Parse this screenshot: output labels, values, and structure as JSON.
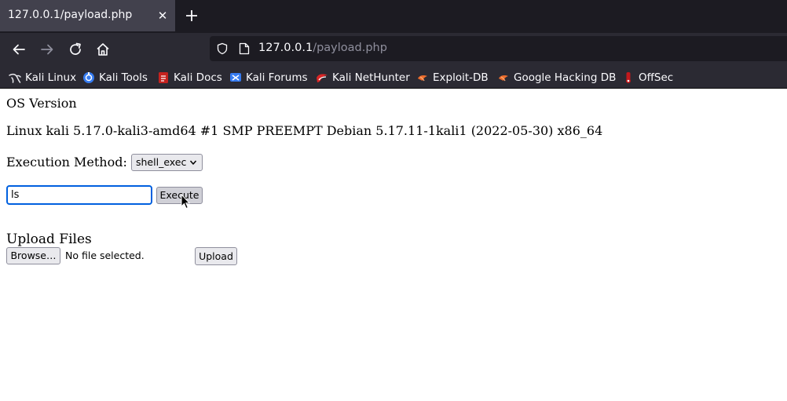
{
  "tab": {
    "title": "127.0.0.1/payload.php",
    "close_glyph": "✕"
  },
  "address_bar": {
    "host": "127.0.0.1",
    "path": "/payload.php"
  },
  "bookmarks": [
    {
      "label": "Kali Linux",
      "icon": "kali-dragon-icon"
    },
    {
      "label": "Kali Tools",
      "icon": "kali-tools-icon"
    },
    {
      "label": "Kali Docs",
      "icon": "kali-docs-icon"
    },
    {
      "label": "Kali Forums",
      "icon": "kali-forums-icon"
    },
    {
      "label": "Kali NetHunter",
      "icon": "kali-nethunter-icon"
    },
    {
      "label": "Exploit-DB",
      "icon": "exploit-db-icon"
    },
    {
      "label": "Google Hacking DB",
      "icon": "ghdb-icon"
    },
    {
      "label": "OffSec",
      "icon": "offsec-icon"
    }
  ],
  "page": {
    "os_heading": "OS Version",
    "os_string": "Linux kali 5.17.0-kali3-amd64 #1 SMP PREEMPT Debian 5.17.11-1kali1 (2022-05-30) x86_64",
    "exec_label": "Execution Method:",
    "exec_method_selected": "shell_exec",
    "command_value": "ls",
    "execute_label": "Execute",
    "upload_heading": "Upload Files",
    "browse_label": "Browse…",
    "file_status": "No file selected.",
    "upload_label": "Upload"
  },
  "colors": {
    "tabbar_bg": "#1c1b22",
    "toolbar_bg": "#2b2a33",
    "active_tab_bg": "#42414d",
    "focus_ring": "#0060df"
  }
}
